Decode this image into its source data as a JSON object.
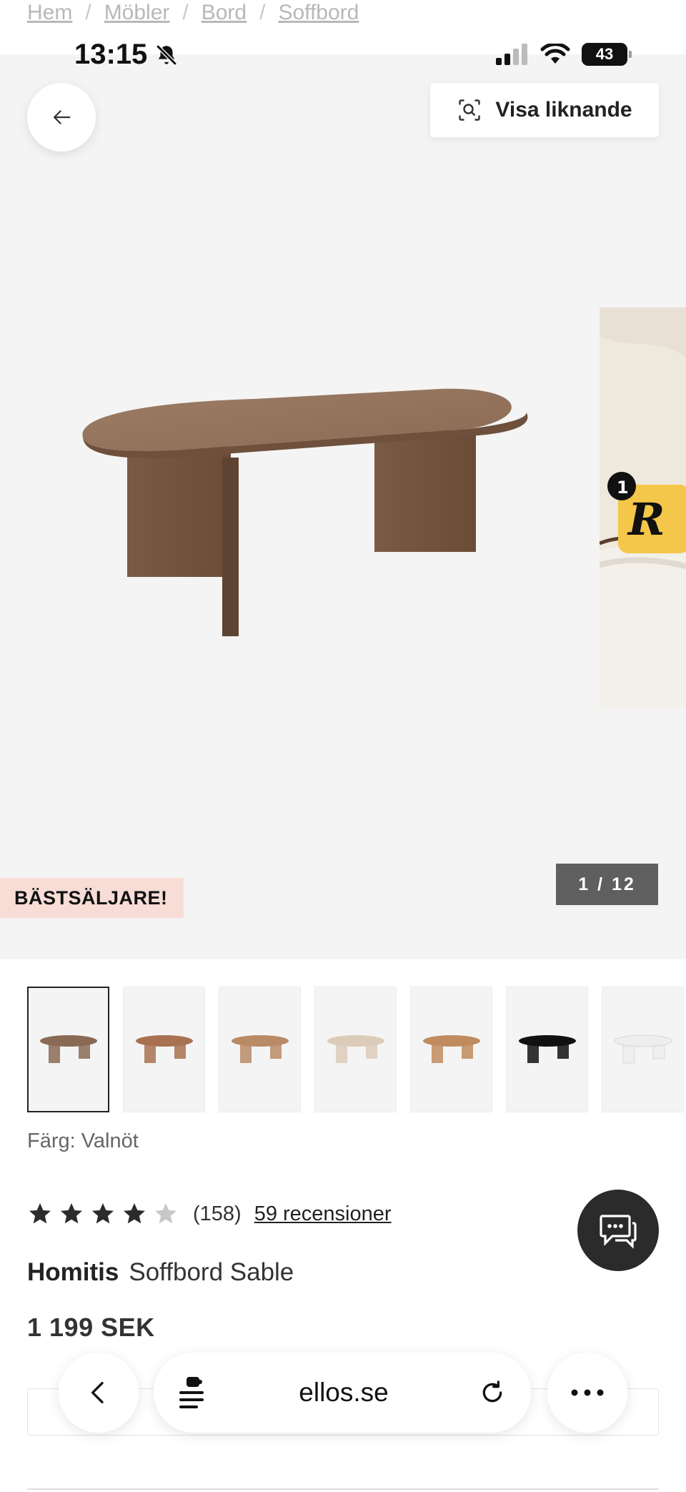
{
  "breadcrumb": {
    "items": [
      "Hem",
      "Möbler",
      "Bord",
      "Soffbord"
    ],
    "separator": "/"
  },
  "status_bar": {
    "time": "13:15",
    "battery": "43"
  },
  "hero": {
    "similar_label": "Visa liknande",
    "badge": "BÄSTSÄLJARE!",
    "counter": "1 / 12",
    "bg_color": "#f5f4f4"
  },
  "thumbnails": {
    "colors": [
      "#8a6a55",
      "#a87152",
      "#b98a66",
      "#dccbb8",
      "#c08b5e",
      "#111111",
      "#eeeeee"
    ],
    "active_index": 0
  },
  "product": {
    "color_line": "Färg: Valnöt",
    "rating_stars": 4,
    "rating_max": 5,
    "rating_count": "(158)",
    "reviews_link": "59 recensioner",
    "brand": "Homitis",
    "name": "Soffbord Sable",
    "price": "1 199 SEK"
  },
  "browser": {
    "url": "ellos.se"
  }
}
